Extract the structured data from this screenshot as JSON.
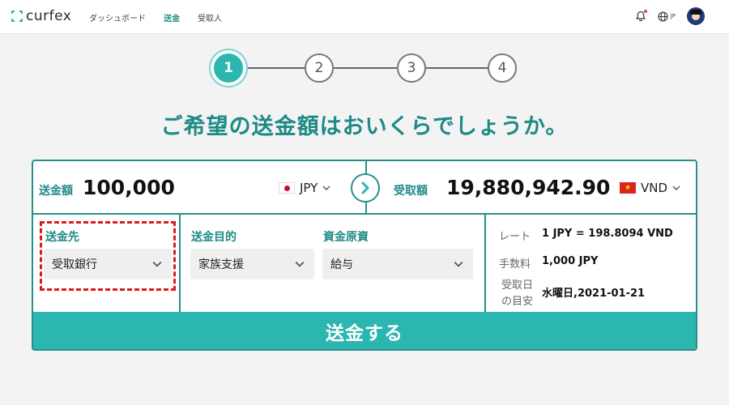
{
  "header": {
    "logo_text": "curfex",
    "nav": [
      {
        "label": "ダッシュボード",
        "active": false
      },
      {
        "label": "送金",
        "active": true
      },
      {
        "label": "受取人",
        "active": false
      }
    ],
    "lang_label": "JP",
    "icons": [
      "bell-icon",
      "globe-icon",
      "avatar"
    ]
  },
  "stepper": {
    "steps": [
      "1",
      "2",
      "3",
      "4"
    ],
    "current": 1
  },
  "headline": "ご希望の送金額はおいくらでしょうか。",
  "send": {
    "label": "送金額",
    "amount": "100,000",
    "currency": "JPY"
  },
  "receive": {
    "label": "受取額",
    "amount": "19,880,942.90",
    "currency": "VND"
  },
  "destination": {
    "label": "送金先",
    "value": "受取銀行"
  },
  "purpose": {
    "label": "送金目的",
    "value": "家族支援"
  },
  "source": {
    "label": "資金原資",
    "value": "給与"
  },
  "info": {
    "rate_label": "レート",
    "rate_value": "1 JPY = 198.8094 VND",
    "fee_label": "手数料",
    "fee_value": "1,000 JPY",
    "eta_label_line1": "受取日",
    "eta_label_line2": "の目安",
    "eta_value": "水曜日,2021-01-21"
  },
  "submit_label": "送金する",
  "colors": {
    "accent": "#2bb6b0",
    "accent_dark": "#1f8a86",
    "highlight_dashed": "#e01818"
  }
}
